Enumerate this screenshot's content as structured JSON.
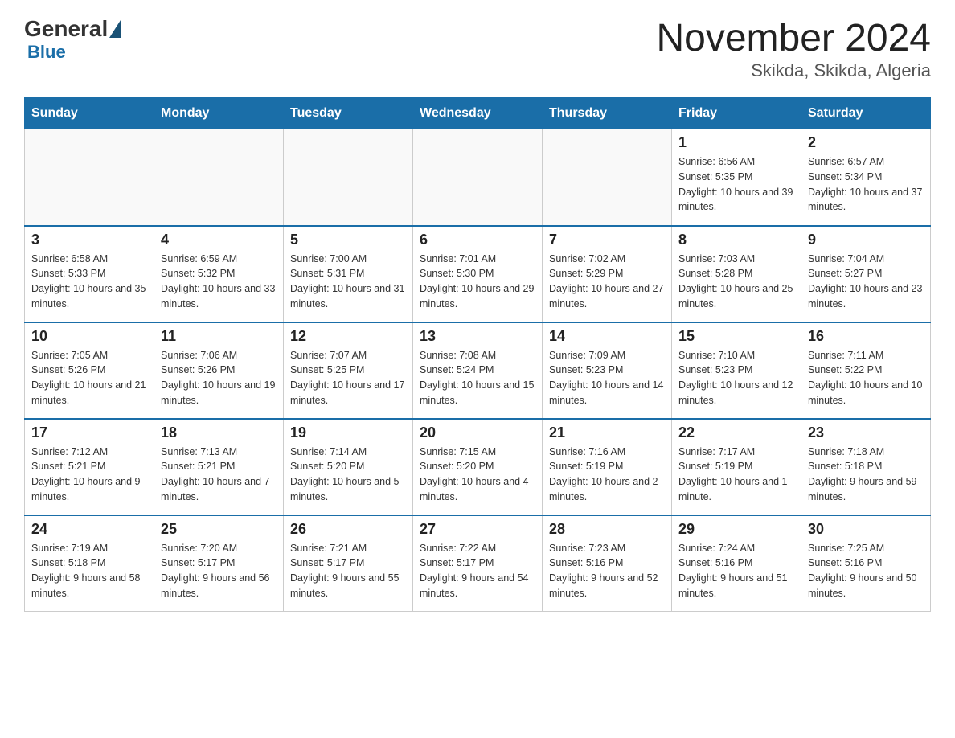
{
  "header": {
    "logo": {
      "general": "General",
      "blue": "Blue"
    },
    "title": "November 2024",
    "location": "Skikda, Skikda, Algeria"
  },
  "days_of_week": [
    "Sunday",
    "Monday",
    "Tuesday",
    "Wednesday",
    "Thursday",
    "Friday",
    "Saturday"
  ],
  "weeks": [
    [
      {
        "day": "",
        "info": ""
      },
      {
        "day": "",
        "info": ""
      },
      {
        "day": "",
        "info": ""
      },
      {
        "day": "",
        "info": ""
      },
      {
        "day": "",
        "info": ""
      },
      {
        "day": "1",
        "info": "Sunrise: 6:56 AM\nSunset: 5:35 PM\nDaylight: 10 hours and 39 minutes."
      },
      {
        "day": "2",
        "info": "Sunrise: 6:57 AM\nSunset: 5:34 PM\nDaylight: 10 hours and 37 minutes."
      }
    ],
    [
      {
        "day": "3",
        "info": "Sunrise: 6:58 AM\nSunset: 5:33 PM\nDaylight: 10 hours and 35 minutes."
      },
      {
        "day": "4",
        "info": "Sunrise: 6:59 AM\nSunset: 5:32 PM\nDaylight: 10 hours and 33 minutes."
      },
      {
        "day": "5",
        "info": "Sunrise: 7:00 AM\nSunset: 5:31 PM\nDaylight: 10 hours and 31 minutes."
      },
      {
        "day": "6",
        "info": "Sunrise: 7:01 AM\nSunset: 5:30 PM\nDaylight: 10 hours and 29 minutes."
      },
      {
        "day": "7",
        "info": "Sunrise: 7:02 AM\nSunset: 5:29 PM\nDaylight: 10 hours and 27 minutes."
      },
      {
        "day": "8",
        "info": "Sunrise: 7:03 AM\nSunset: 5:28 PM\nDaylight: 10 hours and 25 minutes."
      },
      {
        "day": "9",
        "info": "Sunrise: 7:04 AM\nSunset: 5:27 PM\nDaylight: 10 hours and 23 minutes."
      }
    ],
    [
      {
        "day": "10",
        "info": "Sunrise: 7:05 AM\nSunset: 5:26 PM\nDaylight: 10 hours and 21 minutes."
      },
      {
        "day": "11",
        "info": "Sunrise: 7:06 AM\nSunset: 5:26 PM\nDaylight: 10 hours and 19 minutes."
      },
      {
        "day": "12",
        "info": "Sunrise: 7:07 AM\nSunset: 5:25 PM\nDaylight: 10 hours and 17 minutes."
      },
      {
        "day": "13",
        "info": "Sunrise: 7:08 AM\nSunset: 5:24 PM\nDaylight: 10 hours and 15 minutes."
      },
      {
        "day": "14",
        "info": "Sunrise: 7:09 AM\nSunset: 5:23 PM\nDaylight: 10 hours and 14 minutes."
      },
      {
        "day": "15",
        "info": "Sunrise: 7:10 AM\nSunset: 5:23 PM\nDaylight: 10 hours and 12 minutes."
      },
      {
        "day": "16",
        "info": "Sunrise: 7:11 AM\nSunset: 5:22 PM\nDaylight: 10 hours and 10 minutes."
      }
    ],
    [
      {
        "day": "17",
        "info": "Sunrise: 7:12 AM\nSunset: 5:21 PM\nDaylight: 10 hours and 9 minutes."
      },
      {
        "day": "18",
        "info": "Sunrise: 7:13 AM\nSunset: 5:21 PM\nDaylight: 10 hours and 7 minutes."
      },
      {
        "day": "19",
        "info": "Sunrise: 7:14 AM\nSunset: 5:20 PM\nDaylight: 10 hours and 5 minutes."
      },
      {
        "day": "20",
        "info": "Sunrise: 7:15 AM\nSunset: 5:20 PM\nDaylight: 10 hours and 4 minutes."
      },
      {
        "day": "21",
        "info": "Sunrise: 7:16 AM\nSunset: 5:19 PM\nDaylight: 10 hours and 2 minutes."
      },
      {
        "day": "22",
        "info": "Sunrise: 7:17 AM\nSunset: 5:19 PM\nDaylight: 10 hours and 1 minute."
      },
      {
        "day": "23",
        "info": "Sunrise: 7:18 AM\nSunset: 5:18 PM\nDaylight: 9 hours and 59 minutes."
      }
    ],
    [
      {
        "day": "24",
        "info": "Sunrise: 7:19 AM\nSunset: 5:18 PM\nDaylight: 9 hours and 58 minutes."
      },
      {
        "day": "25",
        "info": "Sunrise: 7:20 AM\nSunset: 5:17 PM\nDaylight: 9 hours and 56 minutes."
      },
      {
        "day": "26",
        "info": "Sunrise: 7:21 AM\nSunset: 5:17 PM\nDaylight: 9 hours and 55 minutes."
      },
      {
        "day": "27",
        "info": "Sunrise: 7:22 AM\nSunset: 5:17 PM\nDaylight: 9 hours and 54 minutes."
      },
      {
        "day": "28",
        "info": "Sunrise: 7:23 AM\nSunset: 5:16 PM\nDaylight: 9 hours and 52 minutes."
      },
      {
        "day": "29",
        "info": "Sunrise: 7:24 AM\nSunset: 5:16 PM\nDaylight: 9 hours and 51 minutes."
      },
      {
        "day": "30",
        "info": "Sunrise: 7:25 AM\nSunset: 5:16 PM\nDaylight: 9 hours and 50 minutes."
      }
    ]
  ]
}
